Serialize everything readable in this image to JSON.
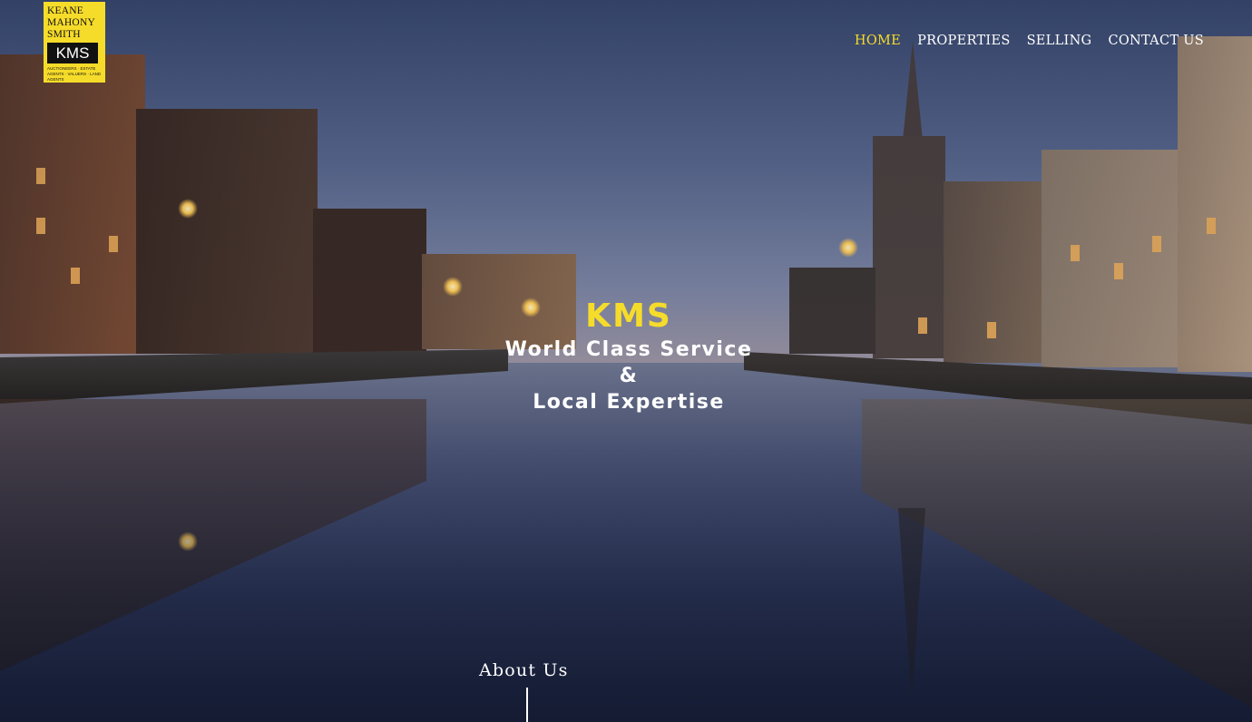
{
  "logo": {
    "line1": "KEANE",
    "line2": "MAHONY",
    "line3": "SMITH",
    "mark": "KMS",
    "tagline": "AUCTIONEERS · ESTATE AGENTS · VALUERS · LAND AGENTS"
  },
  "nav": {
    "items": [
      {
        "label": "HOME",
        "active": true
      },
      {
        "label": "PROPERTIES",
        "active": false
      },
      {
        "label": "SELLING",
        "active": false
      },
      {
        "label": "CONTACT US",
        "active": false
      }
    ]
  },
  "hero": {
    "title": "KMS",
    "line1": "World Class Service",
    "line2": "&",
    "line3": "Local Expertise"
  },
  "about": {
    "label": "About Us"
  },
  "colors": {
    "accent": "#f6dc2a",
    "nav_text": "#ffffff"
  }
}
